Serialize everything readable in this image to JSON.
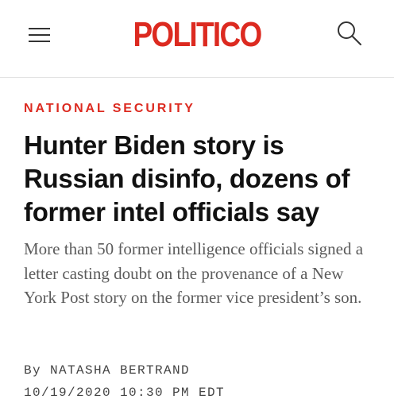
{
  "header": {
    "logo_text": "POLITICO",
    "menu_icon": "hamburger-menu-icon",
    "search_icon": "search-icon",
    "brand_color": "#dc2a20"
  },
  "article": {
    "section": "NATIONAL SECURITY",
    "headline": "Hunter Biden story is Russian disinfo, dozens of former intel officials say",
    "dek": "More than 50 former intelligence officials signed a letter casting doubt on the provenance of a New York Post story on the former vice president’s son.",
    "byline_prefix": "By",
    "author": "NATASHA BERTRAND",
    "timestamp": "10/19/2020 10:30 PM EDT"
  }
}
